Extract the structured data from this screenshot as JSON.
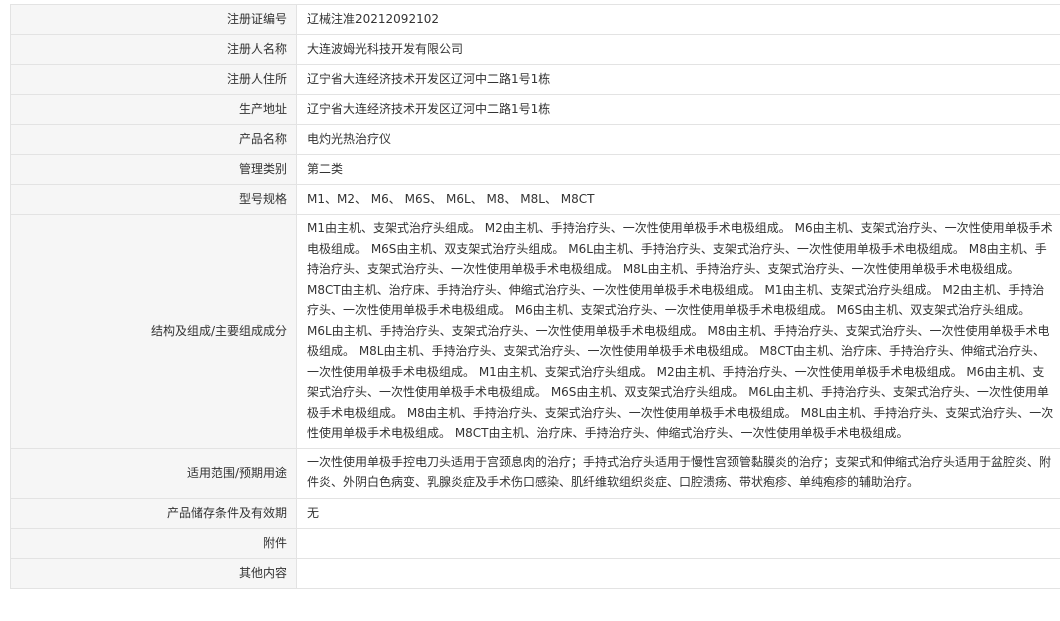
{
  "rows": [
    {
      "label": "注册证编号",
      "value": "辽械注准20212092102"
    },
    {
      "label": "注册人名称",
      "value": "大连波姆光科技开发有限公司"
    },
    {
      "label": "注册人住所",
      "value": "辽宁省大连经济技术开发区辽河中二路1号1栋"
    },
    {
      "label": "生产地址",
      "value": "辽宁省大连经济技术开发区辽河中二路1号1栋"
    },
    {
      "label": "产品名称",
      "value": "电灼光热治疗仪"
    },
    {
      "label": "管理类别",
      "value": "第二类"
    },
    {
      "label": "型号规格",
      "value": "M1、M2、 M6、 M6S、 M6L、 M8、 M8L、 M8CT"
    },
    {
      "label": "结构及组成/主要组成成分",
      "value": "M1由主机、支架式治疗头组成。 M2由主机、手持治疗头、一次性使用单极手术电极组成。 M6由主机、支架式治疗头、一次性使用单极手术电极组成。 M6S由主机、双支架式治疗头组成。 M6L由主机、手持治疗头、支架式治疗头、一次性使用单极手术电极组成。 M8由主机、手持治疗头、支架式治疗头、一次性使用单极手术电极组成。 M8L由主机、手持治疗头、支架式治疗头、一次性使用单极手术电极组成。 M8CT由主机、治疗床、手持治疗头、伸缩式治疗头、一次性使用单极手术电极组成。 M1由主机、支架式治疗头组成。 M2由主机、手持治疗头、一次性使用单极手术电极组成。 M6由主机、支架式治疗头、一次性使用单极手术电极组成。 M6S由主机、双支架式治疗头组成。 M6L由主机、手持治疗头、支架式治疗头、一次性使用单极手术电极组成。 M8由主机、手持治疗头、支架式治疗头、一次性使用单极手术电极组成。 M8L由主机、手持治疗头、支架式治疗头、一次性使用单极手术电极组成。 M8CT由主机、治疗床、手持治疗头、伸缩式治疗头、一次性使用单极手术电极组成。 M1由主机、支架式治疗头组成。 M2由主机、手持治疗头、一次性使用单极手术电极组成。 M6由主机、支架式治疗头、一次性使用单极手术电极组成。 M6S由主机、双支架式治疗头组成。 M6L由主机、手持治疗头、支架式治疗头、一次性使用单极手术电极组成。 M8由主机、手持治疗头、支架式治疗头、一次性使用单极手术电极组成。 M8L由主机、手持治疗头、支架式治疗头、一次性使用单极手术电极组成。 M8CT由主机、治疗床、手持治疗头、伸缩式治疗头、一次性使用单极手术电极组成。"
    },
    {
      "label": "适用范围/预期用途",
      "value": "一次性使用单极手控电刀头适用于宫颈息肉的治疗；手持式治疗头适用于慢性宫颈管黏膜炎的治疗；支架式和伸缩式治疗头适用于盆腔炎、附件炎、外阴白色病变、乳腺炎症及手术伤口感染、肌纤维软组织炎症、口腔溃疡、带状疱疹、单纯疱疹的辅助治疗。"
    },
    {
      "label": "产品储存条件及有效期",
      "value": "无"
    },
    {
      "label": "附件",
      "value": ""
    },
    {
      "label": "其他内容",
      "value": ""
    }
  ]
}
